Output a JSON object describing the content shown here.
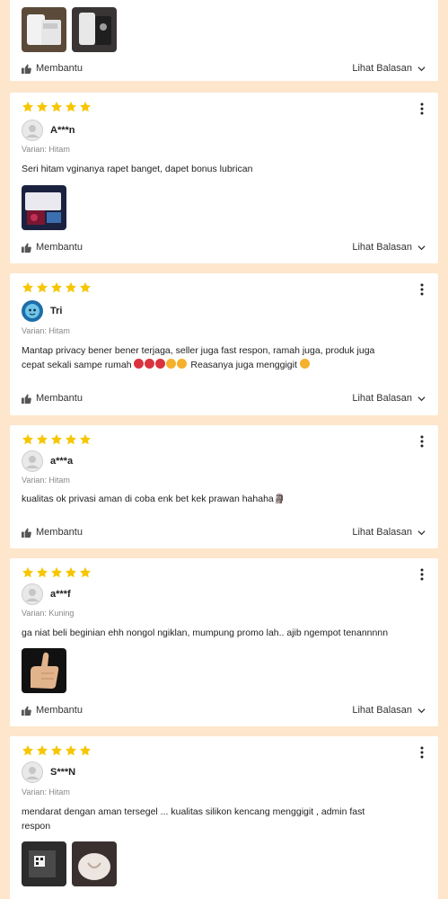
{
  "reviews": [
    {
      "username": "",
      "variant": "",
      "text": "",
      "helpful_label": "Membantu",
      "replies_label": "Lihat Balasan",
      "photos": [
        "product-photo-white",
        "product-photo-black"
      ]
    },
    {
      "username": "A***n",
      "variant": "Varian: Hitam",
      "text": "Seri hitam vginanya rapet banget, dapet bonus lubrican",
      "helpful_label": "Membantu",
      "replies_label": "Lihat Balasan",
      "photos": [
        "product-photo-box"
      ]
    },
    {
      "username": "Tri",
      "variant": "Varian: Hitam",
      "text_line1": "Mantap privacy bener bener terjaga, seller juga fast respon, ramah juga, produk juga",
      "text_line2_prefix": "cepat sekali sampe rumah",
      "text_line2_suffix": "Reasanya juga menggigit",
      "helpful_label": "Membantu",
      "replies_label": "Lihat Balasan"
    },
    {
      "username": "a***a",
      "variant": "Varian: Hitam",
      "text": "kualitas ok privasi aman di coba enk bet kek prawan hahaha🗿",
      "helpful_label": "Membantu",
      "replies_label": "Lihat Balasan"
    },
    {
      "username": "a***f",
      "variant": "Varian: Kuning",
      "text": "ga niat beli beginian ehh nongol ngiklan, mumpung promo lah.. ajib ngempot tenannnnn",
      "helpful_label": "Membantu",
      "replies_label": "Lihat Balasan",
      "photos": [
        "thumbs-up-photo"
      ]
    },
    {
      "username": "S***N",
      "variant": "Varian: Hitam",
      "text_line1": "mendarat dengan aman tersegel ... kualitas silikon kencang menggigit , admin fast",
      "text_line2": "respon",
      "photos": [
        "package-photo",
        "product-photo-closeup"
      ]
    }
  ],
  "colors": {
    "star": "#f7c600",
    "background": "#fde6cc",
    "card": "#ffffff"
  },
  "icons": {
    "star": "star-icon",
    "menu": "more-vertical-icon",
    "helpful": "thumbs-up-icon",
    "replies": "chevron-down-icon"
  }
}
